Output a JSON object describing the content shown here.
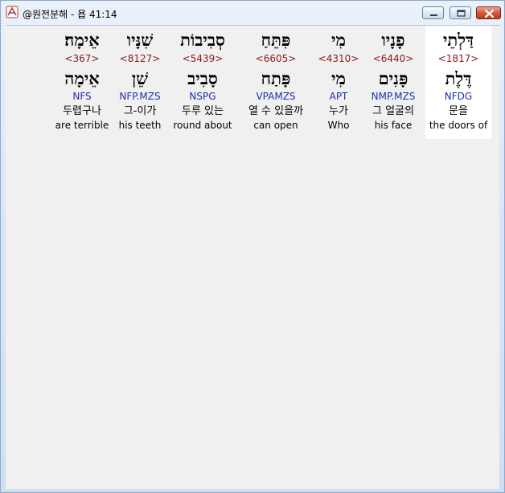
{
  "window": {
    "title": "@원전분해 - 욥 41:14"
  },
  "words": [
    {
      "surface": "אֵימָה׃",
      "strongs": "<367>",
      "lemma": "אֵימָה",
      "morph": "NFS",
      "korean": "두렵구나",
      "english": "are terrible",
      "highlighted": false
    },
    {
      "surface": "שִׁנָּיו",
      "strongs": "<8127>",
      "lemma": "שֵׁן",
      "morph": "NFP.MZS",
      "korean": "그-이가",
      "english": "his teeth",
      "highlighted": false
    },
    {
      "surface": "סְבִיבוֹת",
      "strongs": "<5439>",
      "lemma": "סָבִיב",
      "morph": "NSPG",
      "korean": "두루 있는",
      "english": "round about",
      "highlighted": false
    },
    {
      "surface": "פִּתֵּחַ",
      "strongs": "<6605>",
      "lemma": "פָּתַח",
      "morph": "VPAMZS",
      "korean": "열 수 있을까",
      "english": "can open",
      "highlighted": false
    },
    {
      "surface": "מִי",
      "strongs": "<4310>",
      "lemma": "מִי",
      "morph": "APT",
      "korean": "누가",
      "english": "Who",
      "highlighted": false
    },
    {
      "surface": "פָנָיו",
      "strongs": "<6440>",
      "lemma": "פָּנִים",
      "morph": "NMP.MZS",
      "korean": "그 얼굴의",
      "english": "his face",
      "highlighted": false
    },
    {
      "surface": "דַּלְתֵי",
      "strongs": "<1817>",
      "lemma": "דֶּלֶת",
      "morph": "NFDG",
      "korean": "문을",
      "english": "the doors of",
      "highlighted": true
    }
  ]
}
